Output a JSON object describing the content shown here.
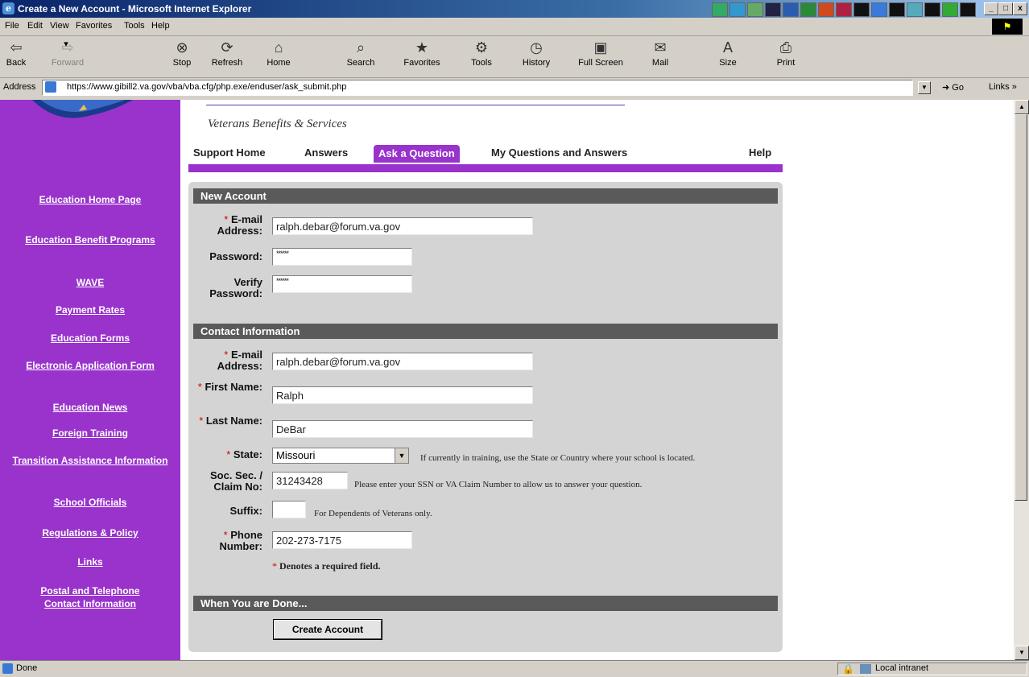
{
  "window": {
    "title": "Create a New Account - Microsoft Internet Explorer",
    "min": "_",
    "max": "□",
    "close": "x"
  },
  "menu": [
    "File",
    "Edit",
    "View",
    "Favorites",
    "Tools",
    "Help"
  ],
  "toolbar": {
    "back": "Back",
    "forward": "Forward",
    "stop": "Stop",
    "refresh": "Refresh",
    "home": "Home",
    "search": "Search",
    "favorites": "Favorites",
    "tools": "Tools",
    "history": "History",
    "fullscreen": "Full Screen",
    "mail": "Mail",
    "size": "Size",
    "print": "Print"
  },
  "address": {
    "label": "Address",
    "url": "https://www.gibill2.va.gov/vba/vba.cfg/php.exe/enduser/ask_submit.php",
    "go": "Go",
    "links": "Links »"
  },
  "sidebar": {
    "items": [
      {
        "label": "Education Home Page"
      },
      {
        "label": "Education Benefit Programs"
      },
      {
        "label": "WAVE"
      },
      {
        "label": "Payment Rates"
      },
      {
        "label": "Education Forms"
      },
      {
        "label": "Electronic Application Form"
      },
      {
        "label": "Education News"
      },
      {
        "label": "Foreign Training"
      },
      {
        "label": "Transition Assistance Information"
      },
      {
        "label": "School Officials"
      },
      {
        "label": "Regulations & Policy"
      },
      {
        "label": "Links"
      },
      {
        "label": "Postal and Telephone Contact Information"
      }
    ]
  },
  "header": {
    "site_name": "Veterans Benefits & Services"
  },
  "tabs": {
    "support_home": "Support Home",
    "answers": "Answers",
    "ask": "Ask a Question",
    "myqa": "My Questions and Answers",
    "help": "Help"
  },
  "new_account": {
    "heading": "New Account",
    "email_label": "E-mail Address:",
    "email_value": "ralph.debar@forum.va.gov",
    "password_label": "Password:",
    "password_value": "******",
    "verify_label": "Verify Password:",
    "verify_value": "******"
  },
  "contact": {
    "heading": "Contact Information",
    "email_label": "E-mail Address:",
    "email_value": "ralph.debar@forum.va.gov",
    "first_label": "First Name:",
    "first_value": "Ralph",
    "last_label": "Last Name:",
    "last_value": "DeBar",
    "state_label": "State:",
    "state_value": "Missouri",
    "state_note": "If currently in training, use the State or Country where your school is located.",
    "ssn_label": "Soc. Sec. / Claim No:",
    "ssn_value": "31243428",
    "ssn_note": "Please enter your SSN or VA Claim Number to allow us to answer your question.",
    "suffix_label": "Suffix:",
    "suffix_value": "",
    "suffix_note": "For Dependents of Veterans only.",
    "phone_label": "Phone Number:",
    "phone_value": "202-273-7175",
    "required_note": "Denotes a required field.",
    "asterisk": "*"
  },
  "done": {
    "heading": "When You are Done...",
    "button": "Create Account"
  },
  "status": {
    "text": "Done",
    "zone": "Local intranet"
  }
}
